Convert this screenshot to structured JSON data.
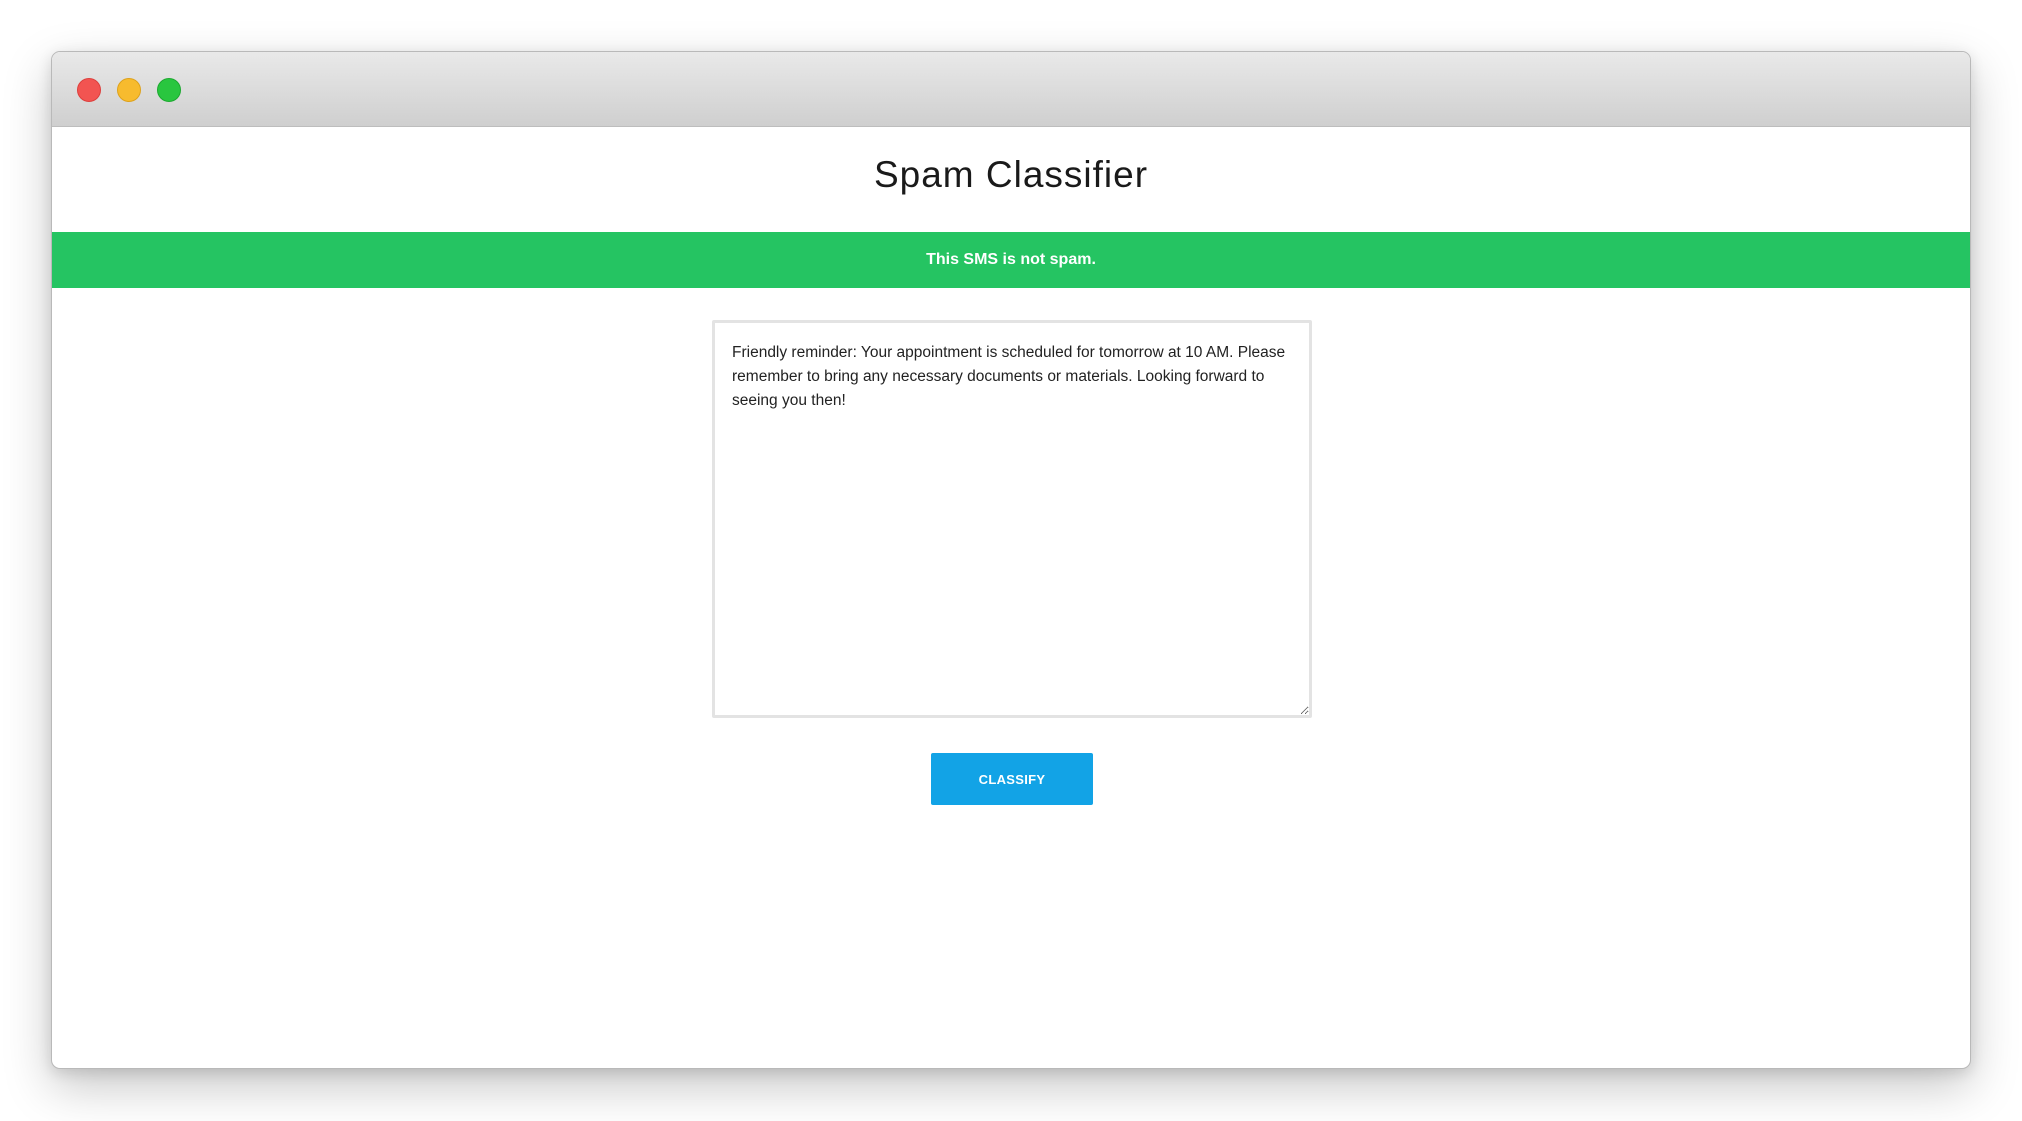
{
  "window": {
    "controls": {
      "close": {
        "icon": "close-light-icon",
        "color": "#f25451"
      },
      "minimize": {
        "icon": "minimize-light-icon",
        "color": "#f7bb2e"
      },
      "maximize": {
        "icon": "maximize-light-icon",
        "color": "#29c63f"
      }
    }
  },
  "page": {
    "title": "Spam Classifier"
  },
  "result": {
    "message": "This SMS is not spam.",
    "status": "not-spam",
    "color": "#25c462"
  },
  "sms_input": {
    "value": "Friendly reminder: Your appointment is scheduled for tomorrow at 10 AM. Please remember to bring any necessary documents or materials. Looking forward to seeing you then!"
  },
  "classify_button": {
    "label": "CLASSIFY",
    "color": "#12a3e6"
  }
}
